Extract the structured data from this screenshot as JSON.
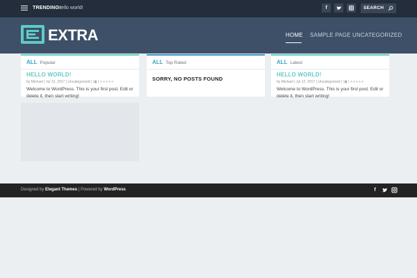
{
  "topbar": {
    "trending_label": "TRENDING:",
    "trending_text": "Hello world!",
    "search_label": "SEARCH",
    "social": [
      "facebook-icon",
      "twitter-icon",
      "instagram-icon"
    ]
  },
  "header": {
    "logo_text": "EXTRA",
    "nav": [
      {
        "label": "HOME"
      },
      {
        "label": "SAMPLE PAGE"
      },
      {
        "label": "UNCATEGORIZED"
      }
    ]
  },
  "cards": [
    {
      "all": "ALL",
      "tab": "Popular",
      "post_title": "HELLO WORLD!",
      "meta_prefix": "by",
      "author": "Michael",
      "date": "Jul 12, 2017",
      "category": "Uncategorized",
      "comments": "1",
      "excerpt": "Welcome to WordPress. This is your first post. Edit or delete it, then start writing!"
    },
    {
      "all": "ALL",
      "tab": "Top Rated",
      "empty_text": "SORRY, NO POSTS FOUND"
    },
    {
      "all": "ALL",
      "tab": "Latest",
      "post_title": "HELLO WORLD!",
      "meta_prefix": "by",
      "author": "Michael",
      "date": "Jul 12, 2017",
      "category": "Uncategorized",
      "comments": "1",
      "excerpt": "Welcome to WordPress. This is your first post. Edit or delete it, then start writing!"
    }
  ],
  "footer": {
    "designed_by": "Designed by",
    "elegant": "Elegant Themes",
    "separator": "|",
    "powered_by": "Powered by",
    "wordpress": "WordPress",
    "social": [
      "facebook-icon",
      "twitter-icon",
      "instagram-icon"
    ]
  },
  "colors": {
    "topbar": "#232d3b",
    "header": "#3d5068",
    "accent": "#5fcbc5",
    "accent_blue": "#3a93c4",
    "footer": "#232323",
    "page": "#eceff2"
  }
}
